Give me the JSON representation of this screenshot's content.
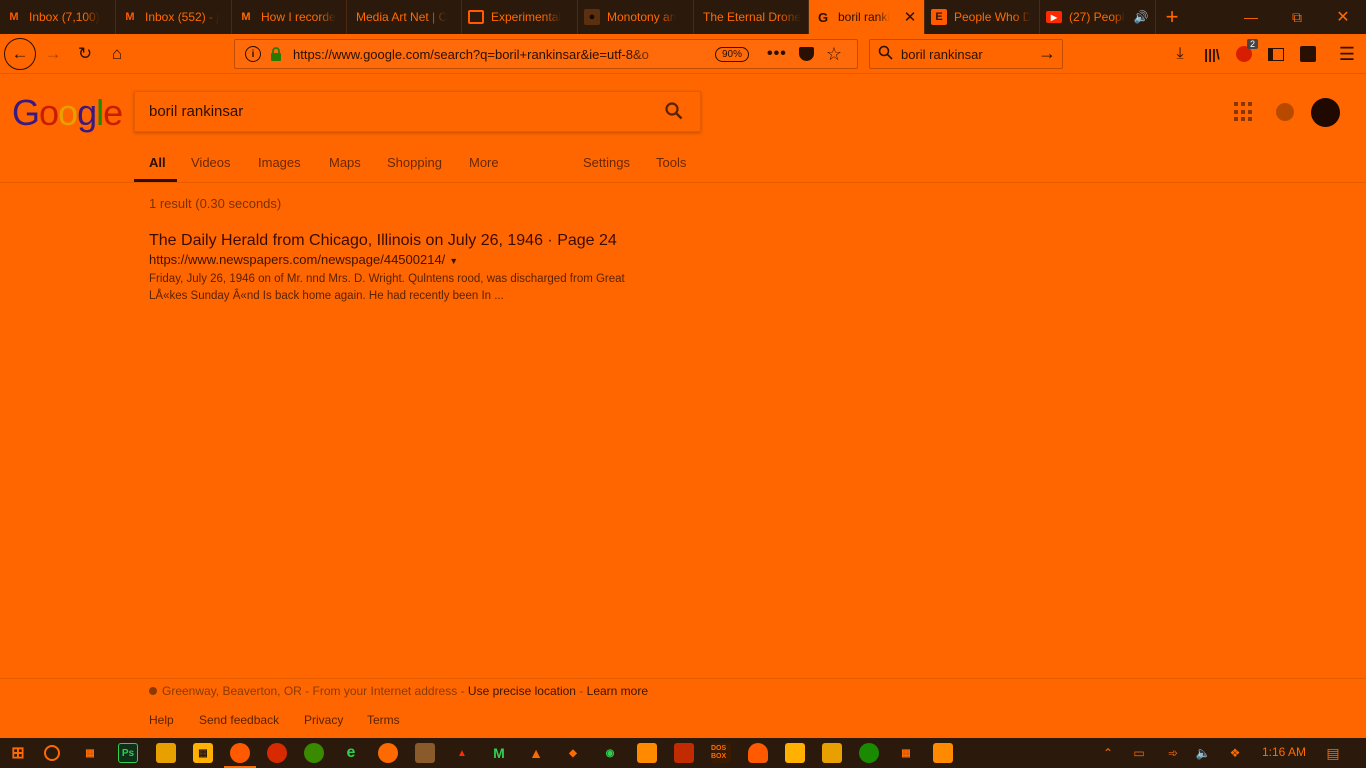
{
  "browser": {
    "tabs": [
      {
        "title": "Inbox (7,100)",
        "favicon": "gmail-icon",
        "active": false
      },
      {
        "title": "Inbox (552) - j",
        "favicon": "gmail-icon",
        "active": false
      },
      {
        "title": "How I recorde",
        "favicon": "medium-icon",
        "active": false
      },
      {
        "title": "Media Art Net | C",
        "favicon": "none",
        "active": false
      },
      {
        "title": "Experimental",
        "favicon": "book-icon",
        "active": false
      },
      {
        "title": "Monotony an",
        "favicon": "mask-icon",
        "active": false
      },
      {
        "title": "The Eternal Drone",
        "favicon": "none",
        "active": false
      },
      {
        "title": "boril ranki",
        "favicon": "google-icon",
        "active": true
      },
      {
        "title": "People Who D",
        "favicon": "e-icon",
        "active": false
      },
      {
        "title": "(27) People",
        "favicon": "youtube-icon",
        "active": false
      }
    ],
    "url": "https://www.google.com/search?q=boril+rankinsar&ie=utf-8&o",
    "zoom": "90%",
    "search_bar_value": "boril rankinsar",
    "adblock_count": "2"
  },
  "google": {
    "logo": "Google",
    "query": "boril rankinsar",
    "tabs": [
      "All",
      "Videos",
      "Images",
      "Maps",
      "Shopping",
      "More"
    ],
    "settings": "Settings",
    "tools": "Tools",
    "stats": "1 result (0.30 seconds)",
    "results": [
      {
        "title": "The Daily Herald from Chicago, Illinois on July 26, 1946 · Page 24",
        "url": "https://www.newspapers.com/newspage/44500214/",
        "snippet_line1": "Friday, July 26, 1946 on of Mr. nnd Mrs. D. Wright. Qulntens rood, was discharged from Great",
        "snippet_line2": "LÅ«kes Sunday Â«nd Is back home again. He had recently been In ..."
      }
    ],
    "footer": {
      "location": "Greenway, Beaverton, OR",
      "location_sep1": " - From your Internet address - ",
      "precise": "Use precise location",
      "location_sep2": " - ",
      "learn": "Learn more",
      "links": [
        "Help",
        "Send feedback",
        "Privacy",
        "Terms"
      ]
    }
  },
  "taskbar": {
    "clock": "1:16 AM"
  },
  "colors": {
    "page_bg": "#ff6600",
    "chrome_dark": "#2b1a0c",
    "text_dark": "#2a1000"
  }
}
